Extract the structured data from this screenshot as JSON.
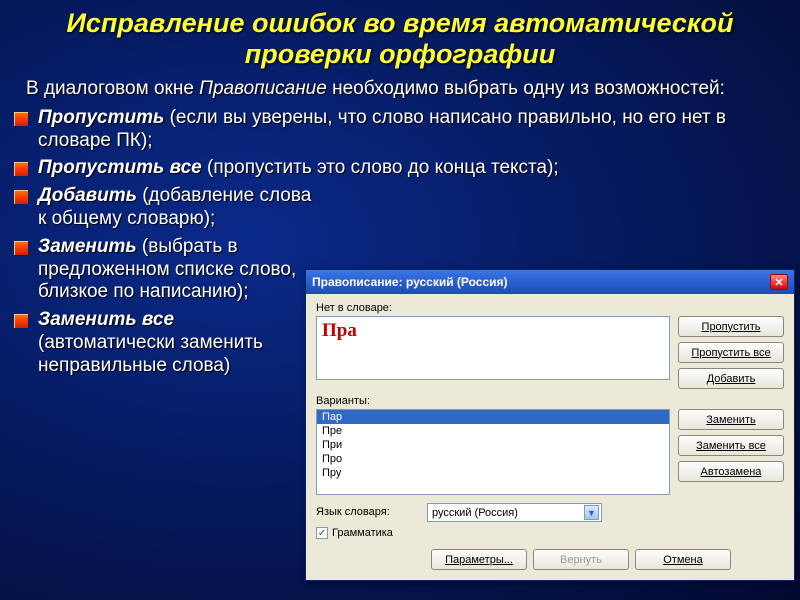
{
  "title": "Исправление ошибок во время автоматической проверки орфографии",
  "intro_prefix": "В диалоговом окне ",
  "intro_em": "Правописание",
  "intro_suffix": " необходимо выбрать одну из возможностей:",
  "items": [
    {
      "bold": "Пропустить",
      "rest": " (если вы уверены, что слово написано правильно, но его нет в словаре ПК);"
    },
    {
      "bold": "Пропустить все",
      "rest": "  (пропустить это слово до конца текста);"
    },
    {
      "bold": "Добавить",
      "rest": "  (добавление слова к общему словарю);"
    },
    {
      "bold": "Заменить",
      "rest": "  (выбрать в предложенном списке слово, близкое по написанию);"
    },
    {
      "bold": "Заменить все",
      "rest": " (автоматически заменить неправильные слова)"
    }
  ],
  "dialog": {
    "title": "Правописание: русский (Россия)",
    "label_not_in_dict": "Нет в словаре:",
    "word": "Пра",
    "label_variants": "Варианты:",
    "variants": [
      "Пар",
      "Пре",
      "При",
      "Про",
      "Пру"
    ],
    "buttons_right1": {
      "skip": "Пропустить",
      "skip_all": "Пропустить все",
      "add": "Добавить"
    },
    "buttons_right2": {
      "replace": "Заменить",
      "replace_all": "Заменить все",
      "autoreplace": "Автозамена"
    },
    "label_lang": "Язык словаря:",
    "lang_value": "русский (Россия)",
    "checkbox_grammar": "Грамматика",
    "footer": {
      "params": "Параметры...",
      "revert": "Вернуть",
      "cancel": "Отмена"
    }
  }
}
